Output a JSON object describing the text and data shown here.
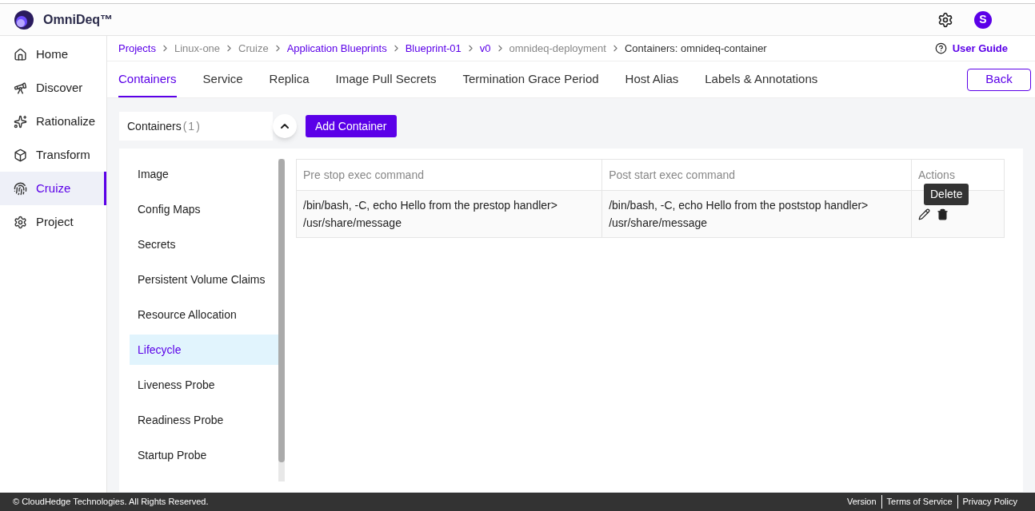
{
  "app": {
    "name": "OmniDeq™",
    "avatar": "S"
  },
  "sidebar": {
    "items": [
      {
        "label": "Home",
        "selected": false
      },
      {
        "label": "Discover",
        "selected": false
      },
      {
        "label": "Rationalize",
        "selected": false
      },
      {
        "label": "Transform",
        "selected": false
      },
      {
        "label": "Cruize",
        "selected": true
      },
      {
        "label": "Project",
        "selected": false
      }
    ]
  },
  "breadcrumbs": [
    {
      "label": "Projects",
      "kind": "link"
    },
    {
      "label": "Linux-one",
      "kind": "plain"
    },
    {
      "label": "Cruize",
      "kind": "plain"
    },
    {
      "label": "Application Blueprints",
      "kind": "link"
    },
    {
      "label": "Blueprint-01",
      "kind": "link"
    },
    {
      "label": "v0",
      "kind": "link"
    },
    {
      "label": "omnideq-deployment",
      "kind": "plain"
    },
    {
      "label": "Containers: omnideq-container",
      "kind": "current"
    }
  ],
  "user_guide": "User Guide",
  "tabs": [
    {
      "label": "Containers",
      "selected": true
    },
    {
      "label": "Service",
      "selected": false
    },
    {
      "label": "Replica",
      "selected": false
    },
    {
      "label": "Image Pull Secrets",
      "selected": false
    },
    {
      "label": "Termination Grace Period",
      "selected": false
    },
    {
      "label": "Host Alias",
      "selected": false
    },
    {
      "label": "Labels & Annotations",
      "selected": false
    }
  ],
  "back_button": "Back",
  "containers_panel": {
    "label": "Containers",
    "count": "(1)",
    "expanded": true
  },
  "add_button": "Add Container",
  "sections": [
    {
      "label": "Image",
      "selected": false
    },
    {
      "label": "Config Maps",
      "selected": false
    },
    {
      "label": "Secrets",
      "selected": false
    },
    {
      "label": "Persistent Volume Claims",
      "selected": false
    },
    {
      "label": "Resource Allocation",
      "selected": false
    },
    {
      "label": "Lifecycle",
      "selected": true
    },
    {
      "label": "Liveness Probe",
      "selected": false
    },
    {
      "label": "Readiness Probe",
      "selected": false
    },
    {
      "label": "Startup Probe",
      "selected": false
    }
  ],
  "table": {
    "columns": [
      "Pre stop exec command",
      "Post start exec command",
      "Actions"
    ],
    "rows": [
      {
        "cells": [
          "/bin/bash, -C, echo Hello from the prestop handler> /usr/share/message",
          "/bin/bash, -C, echo Hello from the poststop handler> /usr/share/message"
        ]
      }
    ]
  },
  "tooltip": "Delete",
  "footer": {
    "copyright": "© CloudHedge Technologies. All Rights Reserved.",
    "links": [
      "Version",
      "Terms of Service",
      "Privacy Policy"
    ]
  }
}
